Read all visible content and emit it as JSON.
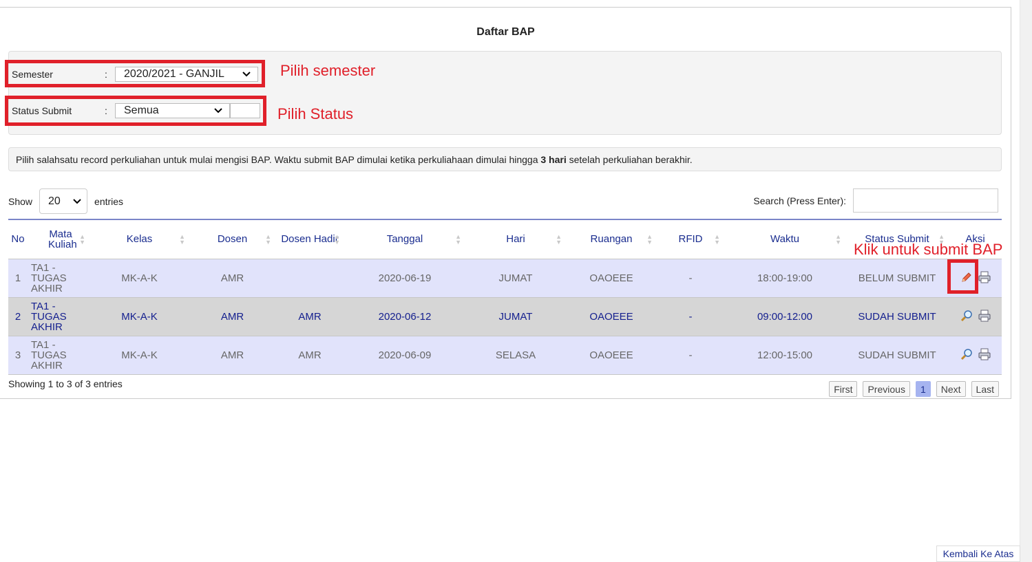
{
  "page": {
    "title": "Daftar BAP"
  },
  "filters": {
    "semester": {
      "label": "Semester",
      "colon": ":",
      "value": "2020/2021 - GANJIL"
    },
    "status": {
      "label": "Status Submit",
      "colon": ":",
      "value": "Semua"
    }
  },
  "annotations": {
    "semester_hint": "Pilih semester",
    "status_hint": "Pilih Status",
    "submit_hint": "Klik untuk submit BAP",
    "highlight_color": "#e0202a"
  },
  "info": {
    "text_before": "Pilih salahsatu record perkuliahan untuk mulai mengisi BAP. Waktu submit BAP dimulai ketika perkuliahaan dimulai hingga ",
    "text_bold": "3 hari",
    "text_after": " setelah perkuliahan berakhir."
  },
  "table_controls": {
    "show_label": "Show",
    "entries_value": "20",
    "entries_label": "entries",
    "search_label": "Search (Press Enter):"
  },
  "table": {
    "headers": [
      "No",
      "Mata Kuliah",
      "Kelas",
      "Dosen",
      "Dosen Hadir",
      "Tanggal",
      "Hari",
      "Ruangan",
      "RFID",
      "Waktu",
      "Status Submit",
      "Aksi"
    ],
    "rows": [
      {
        "no": "1",
        "mk": "TA1 - TUGAS AKHIR",
        "kelas": "MK-A-K",
        "dosen": "AMR",
        "hadir": "",
        "tanggal": "2020-06-19",
        "hari": "JUMAT",
        "ruangan": "OAOEEE",
        "rfid": "-",
        "waktu": "18:00-19:00",
        "status": "BELUM SUBMIT",
        "action": "edit-icon"
      },
      {
        "no": "2",
        "mk": "TA1 - TUGAS AKHIR",
        "kelas": "MK-A-K",
        "dosen": "AMR",
        "hadir": "AMR",
        "tanggal": "2020-06-12",
        "hari": "JUMAT",
        "ruangan": "OAOEEE",
        "rfid": "-",
        "waktu": "09:00-12:00",
        "status": "SUDAH SUBMIT",
        "action": "view-icon"
      },
      {
        "no": "3",
        "mk": "TA1 - TUGAS AKHIR",
        "kelas": "MK-A-K",
        "dosen": "AMR",
        "hadir": "AMR",
        "tanggal": "2020-06-09",
        "hari": "SELASA",
        "ruangan": "OAOEEE",
        "rfid": "-",
        "waktu": "12:00-15:00",
        "status": "SUDAH SUBMIT",
        "action": "view-icon"
      }
    ]
  },
  "footer": {
    "showing": "Showing 1 to 3 of 3 entries",
    "pager": {
      "first": "First",
      "previous": "Previous",
      "page": "1",
      "next": "Next",
      "last": "Last"
    },
    "back_to_top": "Kembali Ke Atas"
  }
}
